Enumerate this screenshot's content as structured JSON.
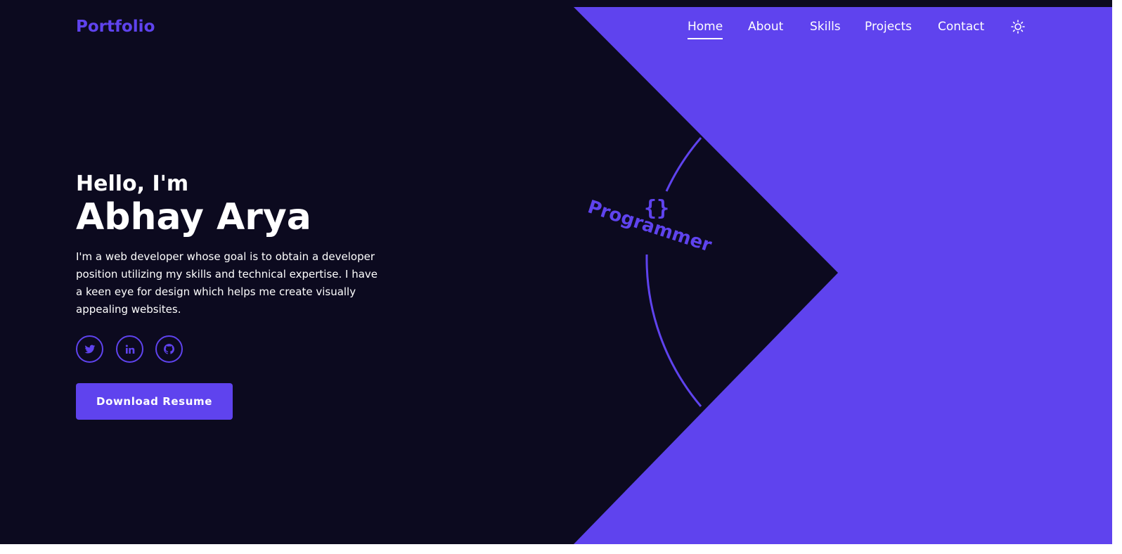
{
  "theme": {
    "background": "#0c0a1f",
    "accent": "#5f43ee",
    "text": "#ffffff"
  },
  "header": {
    "logo": "Portfolio",
    "nav": [
      {
        "label": "Home",
        "active": true
      },
      {
        "label": "About",
        "active": false
      },
      {
        "label": "Skills",
        "active": false
      },
      {
        "label": "Projects",
        "active": false
      },
      {
        "label": "Contact",
        "active": false
      }
    ],
    "theme_toggle_icon": "sun-icon"
  },
  "hero": {
    "greeting": "Hello, I'm",
    "name": "Abhay Arya",
    "bio": "I'm a web developer whose goal is to obtain a developer position utilizing my skills and technical expertise. I have a keen eye for design which helps me create visually appealing websites.",
    "socials": [
      {
        "icon": "twitter-icon"
      },
      {
        "icon": "linkedin-icon"
      },
      {
        "icon": "github-icon"
      }
    ],
    "download_label": "Download Resume"
  },
  "art": {
    "rotating_label": "Programmer",
    "badge_icon": "curly-braces-icon"
  }
}
